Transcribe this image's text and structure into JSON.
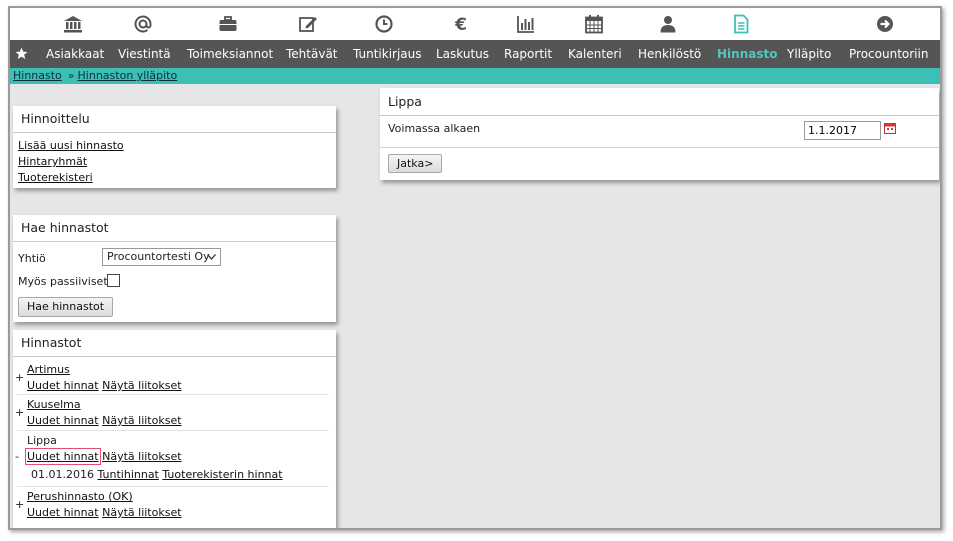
{
  "icons": [
    "institution-icon",
    "at-sign-icon",
    "briefcase-icon",
    "edit-icon",
    "clock-icon",
    "euro-icon",
    "bar-chart-icon",
    "calendar-icon",
    "user-icon",
    "document-icon",
    "arrow-circle-right-icon"
  ],
  "colors": {
    "nav_bg": "#555555",
    "accent": "#3cbfb4",
    "active_nav": "#4ec9bd",
    "highlight": "#e05070"
  },
  "nav": {
    "items": [
      "Asiakkaat",
      "Viestintä",
      "Toimeksiannot",
      "Tehtävät",
      "Tuntikirjaus",
      "Laskutus",
      "Raportit",
      "Kalenteri",
      "Henkilöstö",
      "Hinnasto",
      "Ylläpito",
      "Procountoriin"
    ],
    "active": "Hinnasto"
  },
  "breadcrumb": {
    "first": "Hinnasto",
    "separator": "»",
    "second": "Hinnaston ylläpito"
  },
  "hinnoittelu": {
    "title": "Hinnoittelu",
    "links": [
      "Lisää uusi hinnasto",
      "Hintaryhmät",
      "Tuoterekisteri"
    ]
  },
  "hae": {
    "title": "Hae hinnastot",
    "company_label": "Yhtiö",
    "company_value": "Procountortesti Oy",
    "passive_label": "Myös passiiviset",
    "button": "Hae hinnastot"
  },
  "hinnastot": {
    "title": "Hinnastot",
    "items": [
      {
        "sign": "+",
        "name": "Artimus",
        "new_prices": "Uudet hinnat",
        "show_links": "Näytä liitokset"
      },
      {
        "sign": "+",
        "name": "Kuuselma",
        "new_prices": "Uudet hinnat",
        "show_links": "Näytä liitokset"
      },
      {
        "sign": "-",
        "name": "Lippa",
        "new_prices": "Uudet hinnat",
        "show_links": "Näytä liitokset",
        "sub": {
          "date": "01.01.2016",
          "hourly": "Tuntihinnat",
          "registry_prices": "Tuoterekisterin hinnat"
        }
      },
      {
        "sign": "+",
        "name": "Perushinnasto (OK)",
        "new_prices": "Uudet hinnat",
        "show_links": "Näytä liitokset"
      }
    ]
  },
  "lippa": {
    "title": "Lippa",
    "valid_from_label": "Voimassa alkaen",
    "valid_from_value": "1.1.2017",
    "button": "Jatka>"
  }
}
